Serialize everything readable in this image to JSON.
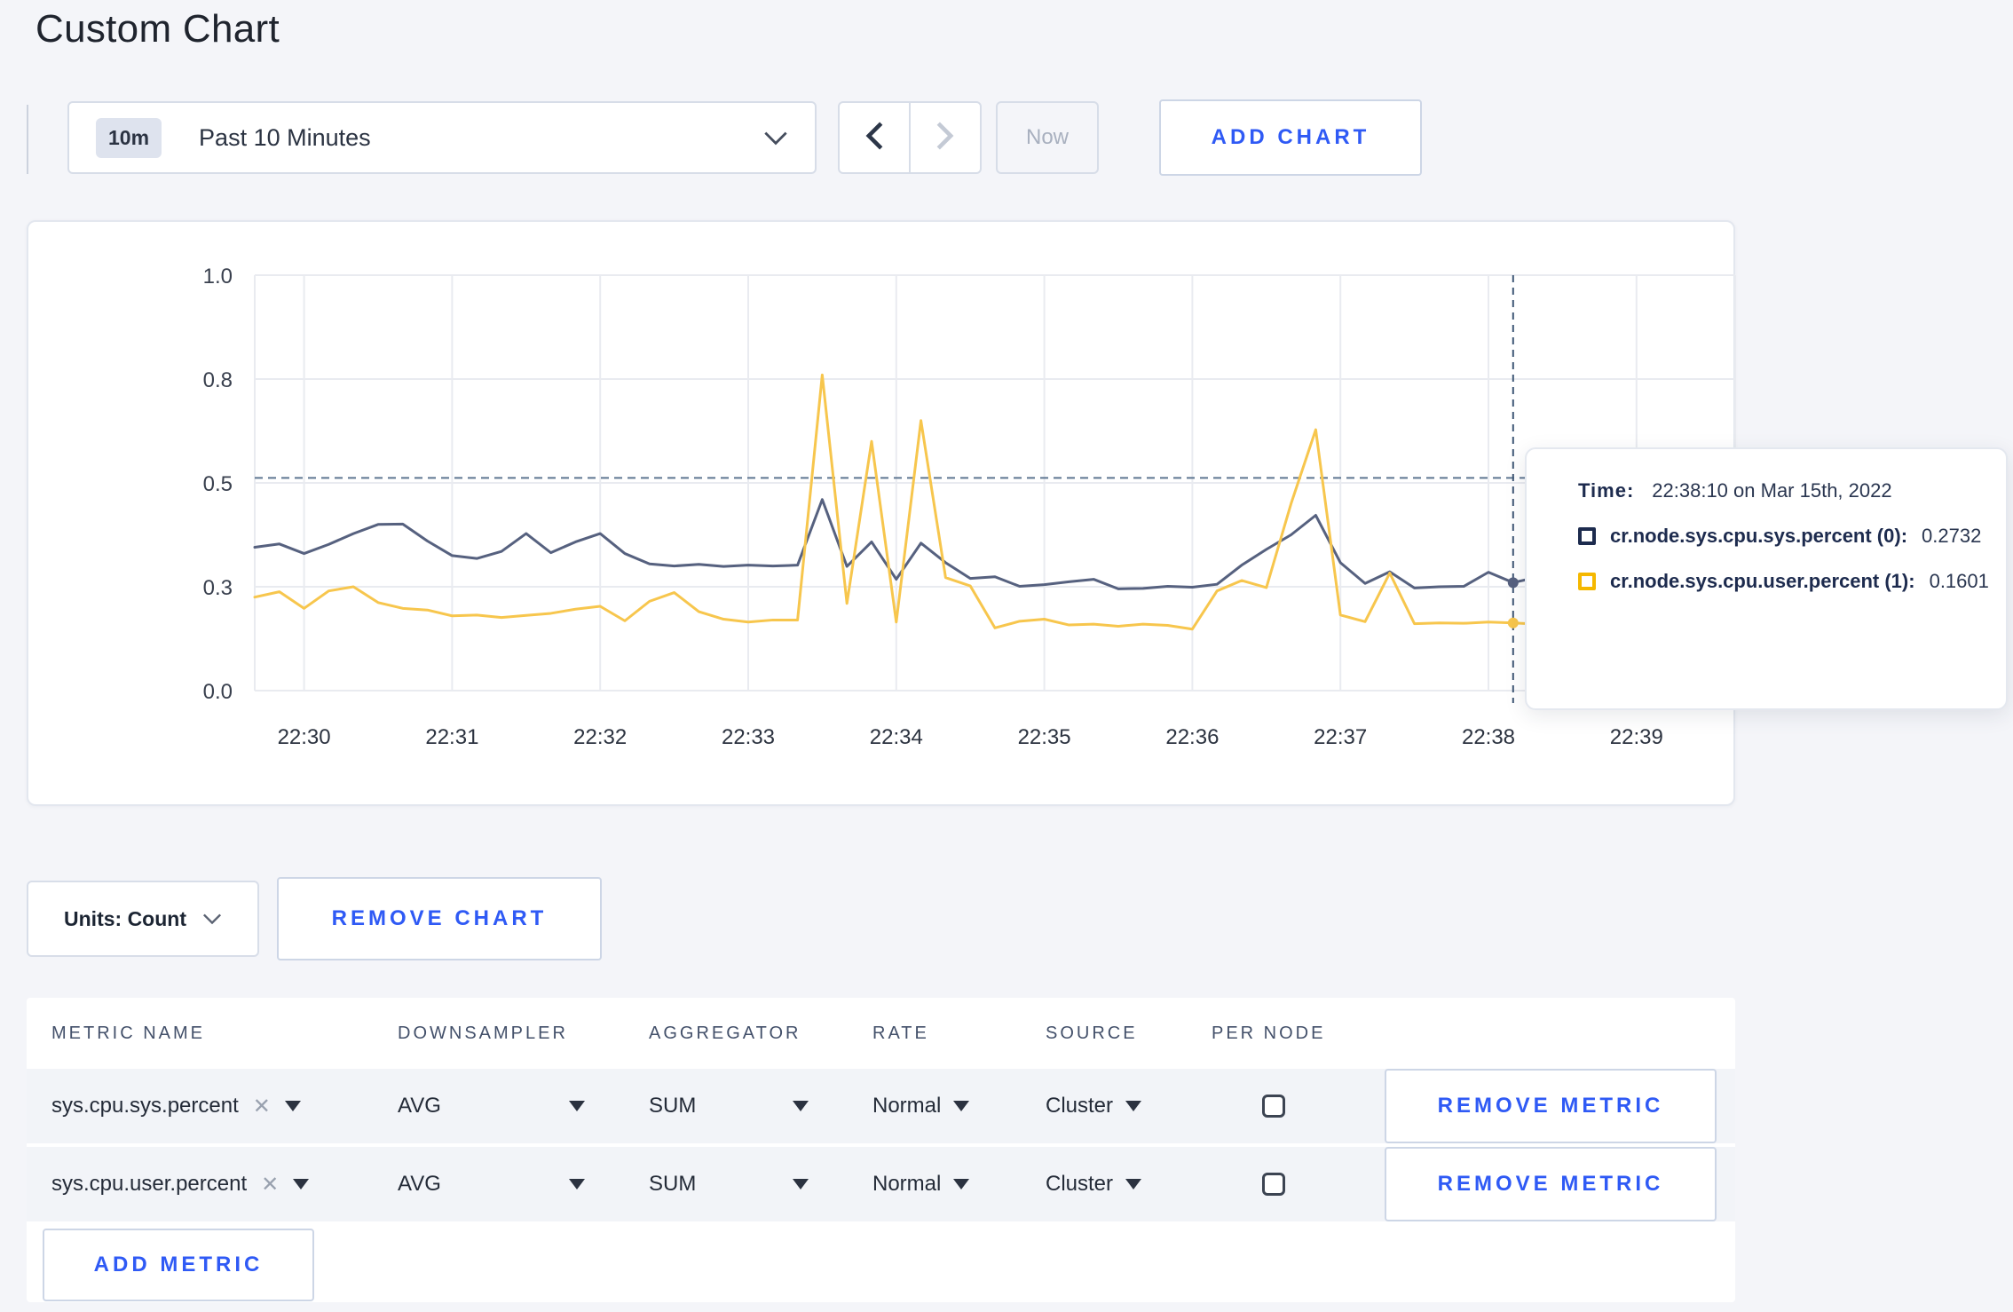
{
  "page_title": "Custom Chart",
  "colors": {
    "accent_blue": "#2f5af5",
    "series_sys_line": "#56617f",
    "series_user_line": "#f7c64d",
    "legend_sys_square": "#1d2b4e",
    "legend_user_square": "#f5b800",
    "crosshair": "#3f5876",
    "gridline": "#e9ebf0"
  },
  "toolbar": {
    "time_selector": {
      "badge": "10m",
      "label": "Past 10 Minutes"
    },
    "now_label": "Now",
    "add_chart_label": "ADD CHART"
  },
  "chart_data": {
    "type": "line",
    "title": "",
    "xlabel": "",
    "ylabel": "",
    "ylim": [
      0,
      1
    ],
    "grid": true,
    "legend_position": "tooltip-only",
    "time_start": "22:29:40",
    "interval_seconds": 10,
    "yticks": [
      {
        "value": 0,
        "label": "0.0"
      },
      {
        "value": 0.25,
        "label": "0.3"
      },
      {
        "value": 0.5,
        "label": "0.5"
      },
      {
        "value": 0.75,
        "label": "0.8"
      },
      {
        "value": 1.0,
        "label": "1.0"
      }
    ],
    "xticks": [
      "22:30",
      "22:31",
      "22:32",
      "22:33",
      "22:34",
      "22:35",
      "22:36",
      "22:37",
      "22:38",
      "22:39"
    ],
    "hover_value_line": 0.512,
    "crosshair": {
      "time": "22:38:10"
    },
    "series": [
      {
        "name": "cr.node.sys.cpu.sys.percent",
        "values": [
          0.345,
          0.353,
          0.33,
          0.352,
          0.378,
          0.4,
          0.401,
          0.36,
          0.325,
          0.318,
          0.335,
          0.378,
          0.332,
          0.358,
          0.378,
          0.33,
          0.305,
          0.3,
          0.304,
          0.299,
          0.302,
          0.3,
          0.302,
          0.46,
          0.299,
          0.358,
          0.268,
          0.355,
          0.308,
          0.27,
          0.274,
          0.251,
          0.255,
          0.262,
          0.268,
          0.245,
          0.246,
          0.251,
          0.249,
          0.256,
          0.302,
          0.34,
          0.375,
          0.422,
          0.308,
          0.258,
          0.286,
          0.247,
          0.25,
          0.251,
          0.285,
          0.26,
          0.2732,
          0.262,
          0.268,
          0.272,
          0.275,
          0.28,
          0.292,
          0.3
        ]
      },
      {
        "name": "cr.node.sys.cpu.user.percent",
        "values": [
          0.225,
          0.238,
          0.198,
          0.24,
          0.25,
          0.212,
          0.198,
          0.194,
          0.18,
          0.182,
          0.176,
          0.181,
          0.186,
          0.196,
          0.203,
          0.168,
          0.215,
          0.236,
          0.19,
          0.172,
          0.165,
          0.17,
          0.17,
          0.76,
          0.21,
          0.6,
          0.165,
          0.65,
          0.272,
          0.252,
          0.151,
          0.167,
          0.172,
          0.158,
          0.16,
          0.155,
          0.16,
          0.157,
          0.148,
          0.24,
          0.265,
          0.248,
          0.45,
          0.628,
          0.182,
          0.166,
          0.283,
          0.161,
          0.163,
          0.162,
          0.165,
          0.163,
          0.1601,
          0.154,
          0.152,
          0.276,
          0.28,
          0.25,
          0.156,
          0.175
        ]
      }
    ]
  },
  "tooltip": {
    "time_label": "Time:",
    "time_value": "22:38:10 on Mar 15th, 2022",
    "series": [
      {
        "label": "cr.node.sys.cpu.sys.percent (0):",
        "value": "0.2732",
        "color": "#1d2b4e"
      },
      {
        "label": "cr.node.sys.cpu.user.percent (1):",
        "value": "0.1601",
        "color": "#f5b800"
      }
    ]
  },
  "footer": {
    "units_label": "Units: Count",
    "remove_chart_label": "REMOVE CHART"
  },
  "metrics_table": {
    "headers": [
      "METRIC NAME",
      "DOWNSAMPLER",
      "AGGREGATOR",
      "RATE",
      "SOURCE",
      "PER NODE"
    ],
    "remove_metric_label": "REMOVE METRIC",
    "add_metric_label": "ADD METRIC",
    "rows": [
      {
        "metric": "sys.cpu.sys.percent",
        "downsampler": "AVG",
        "aggregator": "SUM",
        "rate": "Normal",
        "source": "Cluster",
        "per_node": false
      },
      {
        "metric": "sys.cpu.user.percent",
        "downsampler": "AVG",
        "aggregator": "SUM",
        "rate": "Normal",
        "source": "Cluster",
        "per_node": false
      }
    ]
  }
}
